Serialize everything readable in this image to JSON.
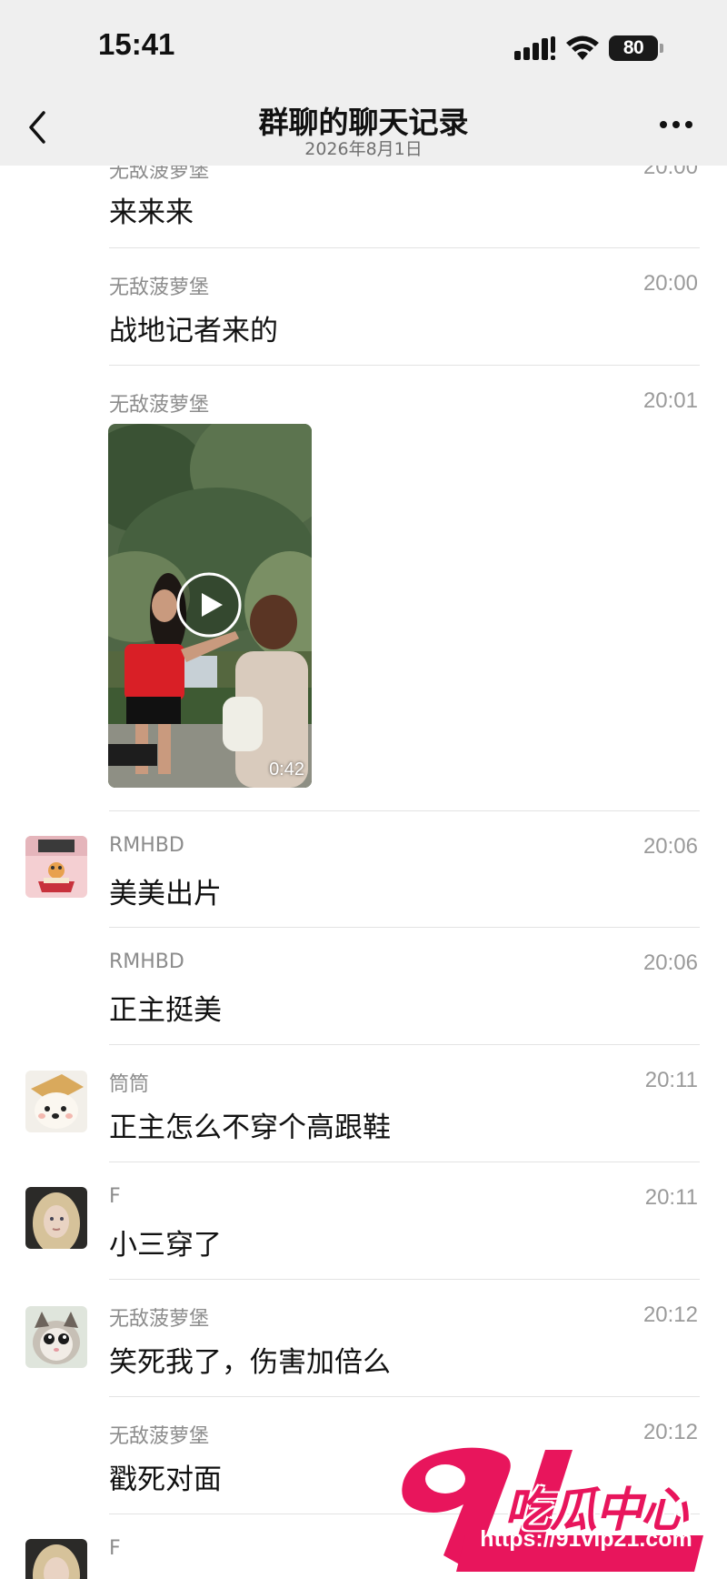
{
  "status_bar": {
    "time": "15:41",
    "battery": "80"
  },
  "nav": {
    "title": "群聊的聊天记录",
    "subtitle": "2026年8月1日"
  },
  "messages": [
    {
      "sender": "无敌菠萝堡",
      "time": "20:00",
      "text": "来来来",
      "avatar": ""
    },
    {
      "sender": "无敌菠萝堡",
      "time": "20:00",
      "text": "战地记者来的",
      "avatar": ""
    },
    {
      "sender": "无敌菠萝堡",
      "time": "20:01",
      "video_duration": "0:42",
      "avatar": ""
    },
    {
      "sender": "RMHBD",
      "time": "20:06",
      "text": "美美出片",
      "avatar": "pink-book-cat"
    },
    {
      "sender": "RMHBD",
      "time": "20:06",
      "text": "正主挺美",
      "avatar": ""
    },
    {
      "sender": "筒筒",
      "time": "20:11",
      "text": "正主怎么不穿个高跟鞋",
      "avatar": "dog-toast"
    },
    {
      "sender": "F",
      "time": "20:11",
      "text": "小三穿了",
      "avatar": "blonde-girl"
    },
    {
      "sender": "无敌菠萝堡",
      "time": "20:12",
      "text": "笑死我了，伤害加倍么",
      "avatar": "kitten"
    },
    {
      "sender": "无敌菠萝堡",
      "time": "20:12",
      "text": "戳死对面",
      "avatar": ""
    },
    {
      "sender": "F",
      "time": "",
      "text": "",
      "avatar": "blonde-girl"
    }
  ],
  "watermark": {
    "logo_number": "91",
    "brand": "吃瓜中心",
    "url": "https://91vip21.com"
  },
  "colors": {
    "header_bg": "#efefef",
    "text": "#111111",
    "meta": "#8c8c8c",
    "brand": "#e8155c"
  }
}
